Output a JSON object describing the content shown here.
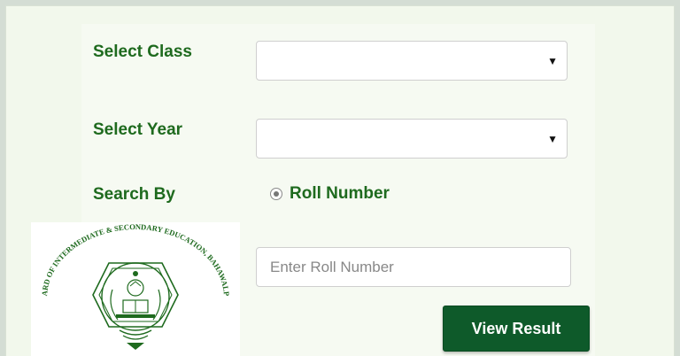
{
  "form": {
    "class_label": "Select Class",
    "class_value": "",
    "year_label": "Select Year",
    "year_value": "",
    "search_by_label": "Search By",
    "search_option": "Roll Number",
    "roll_placeholder": "Enter Roll Number",
    "roll_value": "",
    "submit_label": "View Result"
  },
  "logo": {
    "arc_text": "BOARD OF INTERMEDIATE & SECONDARY EDUCATION, BAHAWALPUR"
  },
  "colors": {
    "label_green": "#1e6a1e",
    "button_bg": "#0e5a2a",
    "panel_bg": "#f6faf2",
    "page_bg": "#f2f8ec"
  },
  "icons": {
    "dropdown": "caret-down-icon",
    "radio": "radio-selected-icon",
    "logo": "bise-emblem-icon"
  }
}
